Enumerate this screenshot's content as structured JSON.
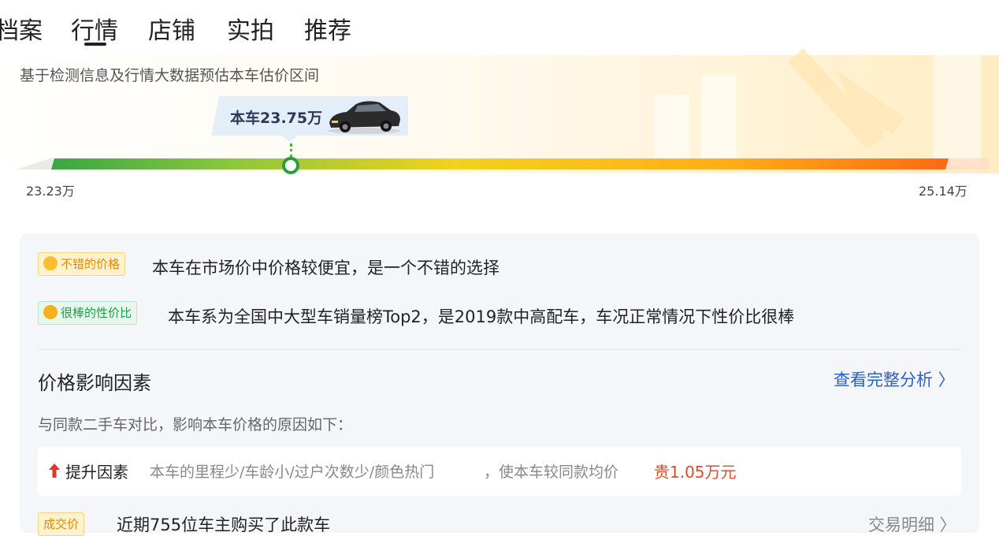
{
  "tabs": [
    {
      "label": "档案"
    },
    {
      "label": "行情",
      "active": true
    },
    {
      "label": "店铺"
    },
    {
      "label": "实拍"
    },
    {
      "label": "推荐"
    }
  ],
  "estimate": {
    "subtitle": "基于检测信息及行情大数据预估本车估价区间",
    "current_label": "本车23.75万",
    "min_label": "23.23万",
    "max_label": "25.14万",
    "position_fraction": 0.27
  },
  "highlights": [
    {
      "tag": "不错的价格",
      "icon": "smile-emoji-icon",
      "text": "本车在市场价中价格较便宜，是一个不错的选择"
    },
    {
      "tag": "很棒的性价比",
      "icon": "star-eyes-emoji-icon",
      "text": "本车系为全国中大型车销量榜Top2，是2019款中高配车，车况正常情况下性价比很棒"
    }
  ],
  "factors": {
    "title": "价格影响因素",
    "link": "查看完整分析 〉",
    "desc": "与同款二手车对比，影响本车价格的原因如下：",
    "up": {
      "label": "提升因素",
      "desc": "本车的里程少/车龄小/过户次数少/颜色热门",
      "desc2": "，使本车较同款均价",
      "highlight": "贵1.05万元"
    }
  },
  "deal": {
    "tag": "成交价",
    "text": "近期755位车主购买了此款车",
    "link": "交易明细 〉"
  },
  "colors": {
    "accent_blue": "#2a60c4",
    "price_up_red": "#e04a2c",
    "green": "#2e9b3f",
    "orange": "#ff6a13"
  }
}
